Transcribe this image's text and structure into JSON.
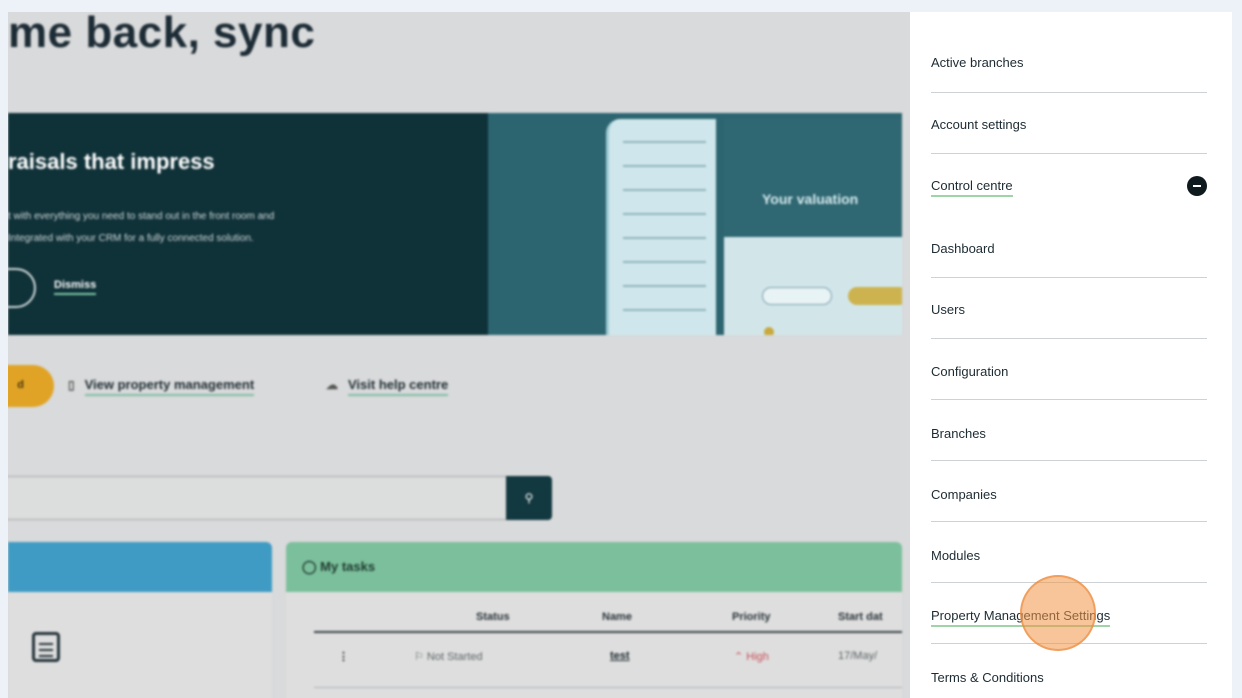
{
  "background_page": {
    "title": "me back, sync",
    "banner": {
      "title": "raisals that impress",
      "line1": "t with everything you need to stand out in the front room and",
      "line2": "Integrated with your CRM for a fully connected solution.",
      "dismiss_label": "Dismiss",
      "preview_heading": "Your valuation"
    },
    "actions": {
      "primary_partial": "d",
      "view_property_management": "View property management",
      "visit_help_centre": "Visit help centre"
    },
    "tasks": {
      "title": "My tasks",
      "columns": [
        "Status",
        "Name",
        "Priority",
        "Start dat"
      ],
      "rows": [
        {
          "status": "Not Started",
          "name": "test",
          "priority": "High",
          "start": "17/May/"
        }
      ]
    }
  },
  "menu": {
    "items": [
      {
        "label": "Active branches"
      },
      {
        "label": "Account settings"
      },
      {
        "label": "Control centre"
      },
      {
        "label": "Dashboard"
      },
      {
        "label": "Users"
      },
      {
        "label": "Configuration"
      },
      {
        "label": "Branches"
      },
      {
        "label": "Companies"
      },
      {
        "label": "Modules"
      },
      {
        "label": "Property Management Settings"
      },
      {
        "label": "Terms & Conditions"
      }
    ]
  },
  "colors": {
    "accent_underline": "#9fd3a8",
    "click_highlight": "#f09646",
    "banner": "#0f3138",
    "cta": "#e0a326"
  }
}
